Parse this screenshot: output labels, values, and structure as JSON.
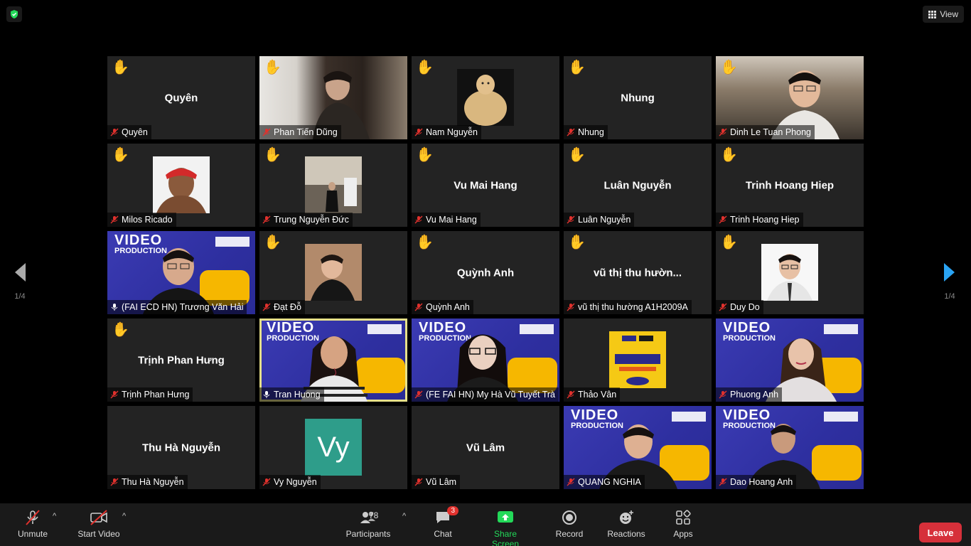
{
  "header": {
    "view_label": "View"
  },
  "pagination": {
    "left_page": "1/4",
    "right_page": "1/4"
  },
  "tiles": [
    {
      "name": "Quyên",
      "center": "Quyên"
    },
    {
      "name": "Phan Tiến Dũng"
    },
    {
      "name": "Nam Nguyễn"
    },
    {
      "name": "Nhung",
      "center": "Nhung"
    },
    {
      "name": "Dinh Le Tuan Phong"
    },
    {
      "name": "Milos Ricado"
    },
    {
      "name": "Trung Nguyễn Đức"
    },
    {
      "name": "Vu Mai Hang",
      "center": "Vu Mai Hang"
    },
    {
      "name": "Luân Nguyễn",
      "center": "Luân Nguyễn"
    },
    {
      "name": "Trinh Hoang Hiep",
      "center": "Trinh Hoang Hiep"
    },
    {
      "name": "(FAI ECD HN) Trương Văn Hải"
    },
    {
      "name": "Đạt Đỗ"
    },
    {
      "name": "Quỳnh Anh",
      "center": "Quỳnh Anh"
    },
    {
      "name": "vũ thị thu hường A1H2009A",
      "center": "vũ thị thu hườn..."
    },
    {
      "name": "Duy Do"
    },
    {
      "name": "Trịnh Phan Hưng",
      "center": "Trịnh Phan Hưng"
    },
    {
      "name": "Tran Huong"
    },
    {
      "name": "(FE FAI HN) My Hà Vũ Tuyết Trà"
    },
    {
      "name": "Thảo Vân"
    },
    {
      "name": "Phuong Anh"
    },
    {
      "name": "Thu Hà Nguyễn",
      "center": "Thu Hà Nguyễn"
    },
    {
      "name": "Vy Nguyễn",
      "avatar_text": "Vy"
    },
    {
      "name": "Vũ Lâm",
      "center": "Vũ Lâm"
    },
    {
      "name": "QUANG NGHIA"
    },
    {
      "name": "Dao Hoang Anh"
    }
  ],
  "video_banner": {
    "title": "VIDEO",
    "subtitle": "PRODUCTION"
  },
  "toolbar": {
    "unmute": "Unmute",
    "start_video": "Start Video",
    "participants": "Participants",
    "participants_count": "78",
    "chat": "Chat",
    "chat_badge": "3",
    "share_screen": "Share Screen",
    "record": "Record",
    "reactions": "Reactions",
    "apps": "Apps",
    "leave": "Leave"
  },
  "colors": {
    "accent_green": "#23d959",
    "leave_red": "#d6303a",
    "active_border": "#e6e08a",
    "banner_blue": "#3b3bb3",
    "banner_yellow": "#f6b700"
  }
}
